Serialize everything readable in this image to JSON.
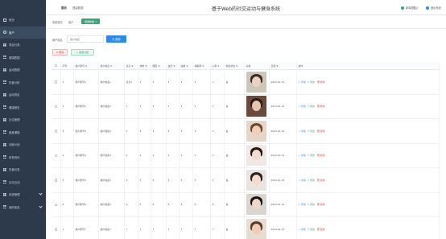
{
  "app": {
    "title": "基于Web的社交运动与健身系统"
  },
  "header": {
    "tabs": [
      {
        "label": "首页"
      },
      {
        "label": "健康数据"
      }
    ],
    "right": {
      "profile_label": "新闻提醒()",
      "logout_label": "退出系统"
    }
  },
  "breadcrumb": {
    "items": [
      "系统首页",
      "用户",
      "健康数据 ×"
    ]
  },
  "sidebar": {
    "items": [
      {
        "label": "首页",
        "icon": "home-icon"
      },
      {
        "label": "用户",
        "icon": "user-icon"
      },
      {
        "label": "项目分类",
        "icon": "grid-icon"
      },
      {
        "label": "健康数据",
        "icon": "grid-icon"
      },
      {
        "label": "运动数据",
        "icon": "grid-icon"
      },
      {
        "label": "饮食分析",
        "icon": "grid-icon"
      },
      {
        "label": "运动项目",
        "icon": "grid-icon"
      },
      {
        "label": "健康报告",
        "icon": "grid-icon"
      },
      {
        "label": "社交管理",
        "icon": "grid-icon"
      },
      {
        "label": "健身课程",
        "icon": "grid-icon"
      },
      {
        "label": "训练计划",
        "icon": "grid-icon"
      },
      {
        "label": "体育资讯",
        "icon": "grid-icon"
      },
      {
        "label": "饮食记录",
        "icon": "grid-icon"
      },
      {
        "label": "社交互动",
        "icon": "grid-icon"
      },
      {
        "label": "系统管理",
        "icon": "grid-icon",
        "has_chevron": true
      },
      {
        "label": "我的信息",
        "icon": "grid-icon",
        "has_chevron": true
      }
    ]
  },
  "search": {
    "label": "用户姓名",
    "placeholder": "用户姓名",
    "button_label": "Q 查询"
  },
  "actions": {
    "delete_label": "⊖ 删除",
    "add_label": "+ 健康分析"
  },
  "table": {
    "headers": [
      "序号",
      "用户账号 ⇅",
      "用户姓名 ⇅",
      "身高 ⇅",
      "体重 ⇅",
      "腰围 ⇅",
      "血压 ⇅",
      "血糖 ⇅",
      "体脂率 ⇅",
      "心率 ⇅",
      "健康状态 ⇅",
      "头像",
      "日期 ⇅",
      "操作"
    ],
    "rows": [
      {
        "index": "1",
        "account": "用户账号1",
        "name": "用户姓名1",
        "height": "身高1",
        "weight": "1",
        "waist": "1",
        "bp": "1",
        "sugar": "1",
        "fat": "1",
        "heart": "1",
        "status": "良",
        "date": "2024-01-12",
        "skin": "#e9d2c4",
        "hair": "#3a2a22",
        "bg": "#cfc6bb"
      },
      {
        "index": "2",
        "account": "用户账号2",
        "name": "用户姓名2",
        "height": "2",
        "weight": "2",
        "waist": "2",
        "bp": "2",
        "sugar": "2",
        "fat": "2",
        "heart": "2",
        "status": "良",
        "date": "2024-01-12",
        "skin": "#e8c6ad",
        "hair": "#2b1d18",
        "bg": "#6b4a3d"
      },
      {
        "index": "3",
        "account": "用户账号3",
        "name": "用户姓名3",
        "height": "3",
        "weight": "3",
        "waist": "3",
        "bp": "3",
        "sugar": "3",
        "fat": "3",
        "heart": "3",
        "status": "良",
        "date": "2024-01-12",
        "skin": "#f0cfb8",
        "hair": "#6b4630",
        "bg": "#e4d6c8"
      },
      {
        "index": "4",
        "account": "用户账号4",
        "name": "用户姓名4",
        "height": "4",
        "weight": "4",
        "waist": "4",
        "bp": "4",
        "sugar": "4",
        "fat": "4",
        "heart": "4",
        "status": "良",
        "date": "2024-01-12",
        "skin": "#f2dccd",
        "hair": "#1f1815",
        "bg": "#efe8e4"
      },
      {
        "index": "5",
        "account": "用户账号5",
        "name": "用户姓名5",
        "height": "5",
        "weight": "5",
        "waist": "5",
        "bp": "5",
        "sugar": "5",
        "fat": "5",
        "heart": "5",
        "status": "良",
        "date": "2024-01-12",
        "skin": "#f3dccb",
        "hair": "#2c221d",
        "bg": "#e8e5e0"
      },
      {
        "index": "6",
        "account": "用户账号6",
        "name": "用户姓名6",
        "height": "6",
        "weight": "6",
        "waist": "6",
        "bp": "6",
        "sugar": "6",
        "fat": "6",
        "heart": "6",
        "status": "良",
        "date": "2024-01-12",
        "skin": "#efd8c8",
        "hair": "#1a1412",
        "bg": "#d9d6d2"
      },
      {
        "index": "7",
        "account": "用户账号7",
        "name": "用户姓名7",
        "height": "7",
        "weight": "7",
        "waist": "7",
        "bp": "7",
        "sugar": "7",
        "fat": "7",
        "heart": "7",
        "status": "良",
        "date": "2024-01-12",
        "skin": "#efcdb5",
        "hair": "#5a3b2a",
        "bg": "#e6dcd2"
      }
    ],
    "ops": {
      "detail": "▭ 详情",
      "edit": "✎ 修改",
      "delete": "🗑 删除"
    }
  }
}
